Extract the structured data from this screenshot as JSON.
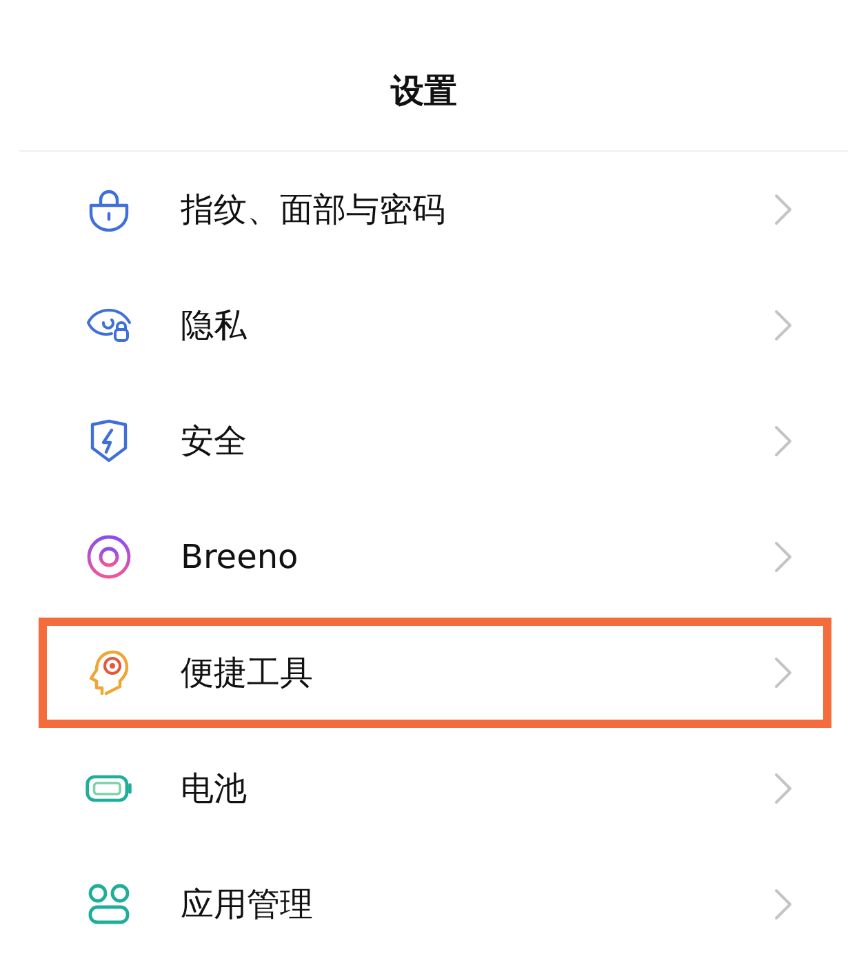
{
  "header": {
    "title": "设置"
  },
  "items": [
    {
      "label": "指纹、面部与密码",
      "highlighted": false
    },
    {
      "label": "隐私",
      "highlighted": false
    },
    {
      "label": "安全",
      "highlighted": false
    },
    {
      "label": "Breeno",
      "highlighted": false
    },
    {
      "label": "便捷工具",
      "highlighted": true
    },
    {
      "label": "电池",
      "highlighted": false
    },
    {
      "label": "应用管理",
      "highlighted": false
    }
  ]
}
